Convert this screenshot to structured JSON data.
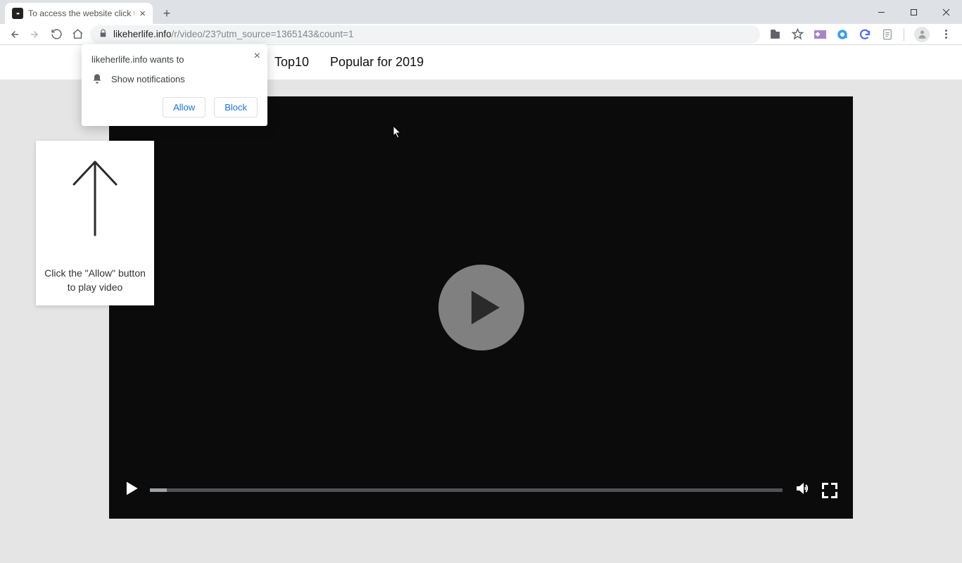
{
  "browser": {
    "tab_title": "To access the website click the \"A",
    "url_domain": "likeherlife.info",
    "url_rest": "/r/video/23?utm_source=1365143&count=1",
    "icons": {
      "translate": "translate-icon",
      "star": "star-icon",
      "ext1": "flag-extension-icon",
      "ext2": "quicktime-extension-icon",
      "ext3": "sync-extension-icon",
      "ext4": "sheet-extension-icon"
    }
  },
  "site_nav": {
    "top10": "Top10",
    "popular": "Popular for 2019"
  },
  "permission": {
    "title": "likeherlife.info wants to",
    "line": "Show notifications",
    "allow": "Allow",
    "block": "Block"
  },
  "instruction": {
    "line1": "Click the \"Allow\" button",
    "line2": "to play video"
  }
}
